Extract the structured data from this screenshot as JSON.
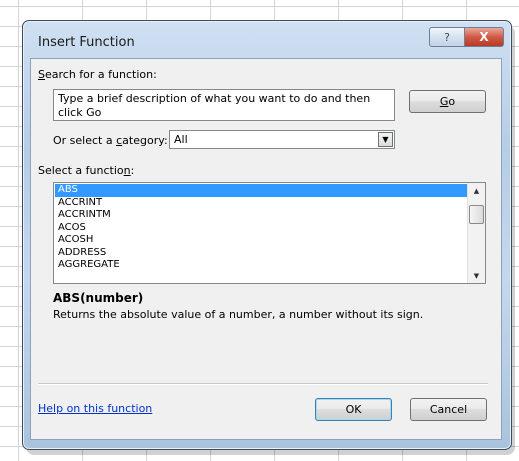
{
  "dialog": {
    "title": "Insert Function",
    "help_glyph": "?",
    "close_glyph": "X"
  },
  "search": {
    "label_pre": "",
    "label_key": "S",
    "label_post": "earch for a function:",
    "value": "Type a brief description of what you want to do and then click Go",
    "go_pre": "",
    "go_key": "G",
    "go_post": "o"
  },
  "category": {
    "label_pre": "Or select a ",
    "label_key": "c",
    "label_post": "ategory:",
    "selected": "All"
  },
  "functions": {
    "label_pre": "Select a functio",
    "label_key": "n",
    "label_post": ":",
    "items": [
      "ABS",
      "ACCRINT",
      "ACCRINTM",
      "ACOS",
      "ACOSH",
      "ADDRESS",
      "AGGREGATE"
    ],
    "selected_index": 0
  },
  "detail": {
    "syntax": "ABS(number)",
    "description": "Returns the absolute value of a number, a number without its sign."
  },
  "footer": {
    "help_link": "Help on this function",
    "ok": "OK",
    "cancel": "Cancel"
  },
  "icons": {
    "dropdown": "chevron-down-icon",
    "scroll_up": "scroll-up-arrow-icon",
    "scroll_down": "scroll-down-arrow-icon"
  }
}
